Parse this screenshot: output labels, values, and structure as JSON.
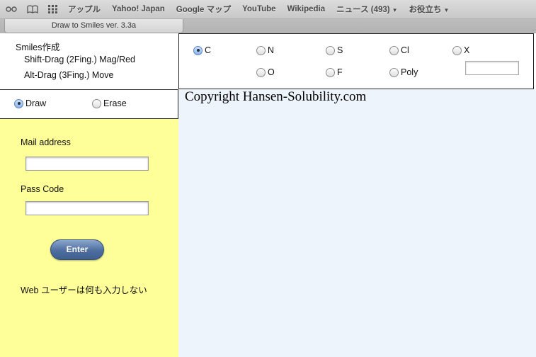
{
  "bookmarks_bar": {
    "items": [
      {
        "label": "アップル",
        "dropdown": false
      },
      {
        "label": "Yahoo! Japan",
        "dropdown": false
      },
      {
        "label": "Google マップ",
        "dropdown": false
      },
      {
        "label": "YouTube",
        "dropdown": false
      },
      {
        "label": "Wikipedia",
        "dropdown": false
      },
      {
        "label": "ニュース (493)",
        "dropdown": true
      },
      {
        "label": "お役立ち",
        "dropdown": true
      }
    ],
    "icons": [
      "reading-list-icon",
      "bookmarks-book-icon",
      "top-sites-grid-icon"
    ]
  },
  "tab": {
    "title": "Draw to Smiles ver. 3.3a"
  },
  "smiles_panel": {
    "title": "Smiles作成",
    "hint_1": "Shift-Drag (2Fing.) Mag/Red",
    "hint_2": "Alt-Drag (3Fing.) Move"
  },
  "atoms": {
    "selected": "C",
    "options": [
      "C",
      "N",
      "S",
      "Cl",
      "X",
      "O",
      "F",
      "Poly"
    ],
    "x_value": ""
  },
  "mode": {
    "selected": "Draw",
    "options": [
      "Draw",
      "Erase"
    ]
  },
  "login": {
    "mail_label": "Mail address",
    "mail_value": "",
    "pass_label": "Pass Code",
    "pass_value": "",
    "enter_label": "Enter",
    "note": "Web ユーザーは何も入力しない"
  },
  "canvas": {
    "copyright": "Copyright Hansen-Solubility.com",
    "background": "#eef4fb"
  },
  "colors": {
    "login_panel_bg": "#ffff99",
    "button_blue": "#4e6e9f",
    "radio_checked": "#8fb3e4"
  }
}
